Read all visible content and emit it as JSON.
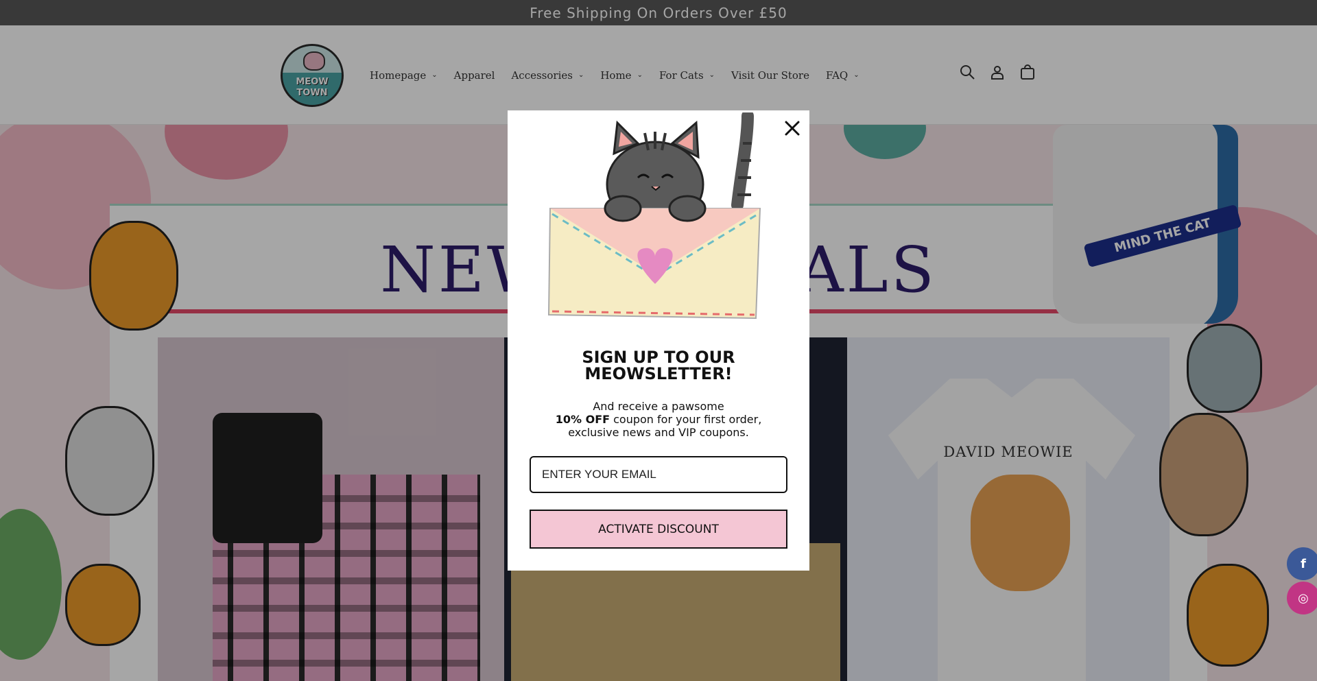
{
  "announcement": {
    "text": "Free Shipping On Orders Over £50"
  },
  "header": {
    "logo_text": [
      "MEOW",
      "TOWN"
    ],
    "nav": [
      {
        "label": "Homepage",
        "has_dropdown": true
      },
      {
        "label": "Apparel",
        "has_dropdown": false
      },
      {
        "label": "Accessories",
        "has_dropdown": true
      },
      {
        "label": "Home",
        "has_dropdown": true
      },
      {
        "label": "For Cats",
        "has_dropdown": true
      },
      {
        "label": "Visit Our Store",
        "has_dropdown": false
      },
      {
        "label": "FAQ",
        "has_dropdown": true
      }
    ],
    "icons": [
      "search-icon",
      "account-icon",
      "cart-icon"
    ]
  },
  "hero": {
    "banner_title": "NEW ARRIVALS",
    "tshirt_text": "DAVID MEOWIE",
    "mug_text": "MIND THE CAT"
  },
  "popup": {
    "title_line1": "SIGN UP TO OUR",
    "title_line2": "MEOWSLETTER!",
    "body_line1": "And receive a pawsome",
    "body_bold": "10% OFF",
    "body_line2_rest": " coupon for your first order,",
    "body_line3": "exclusive news and VIP coupons.",
    "email_placeholder": "ENTER YOUR EMAIL",
    "cta_label": "ACTIVATE DISCOUNT"
  },
  "social": [
    {
      "name": "facebook-icon",
      "glyph": "f",
      "color": "#3b5998"
    },
    {
      "name": "instagram-icon",
      "glyph": "◎",
      "color": "#c13584"
    }
  ],
  "colors": {
    "announce_bg": "#585858",
    "cta_bg": "#f4c6d4",
    "banner_title": "#2d1c6a"
  }
}
